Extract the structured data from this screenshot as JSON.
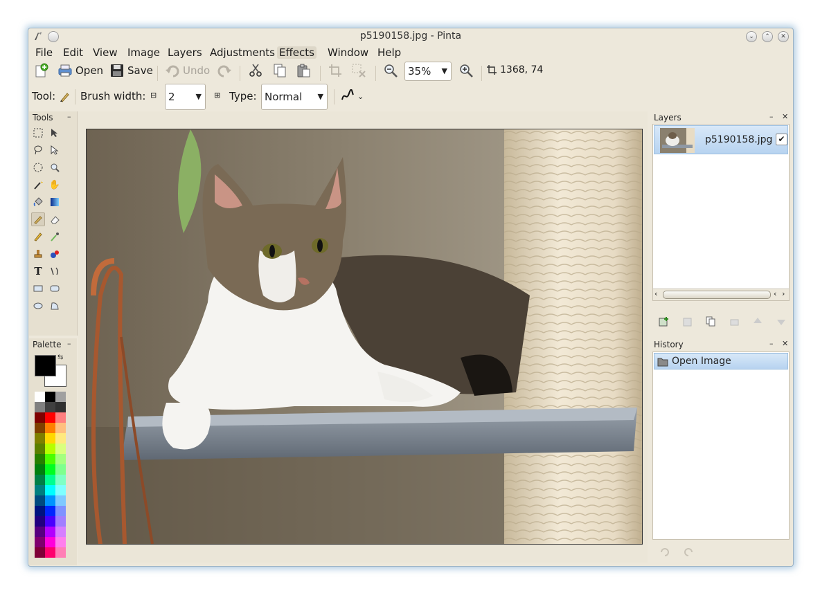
{
  "window": {
    "title": "p5190158.jpg - Pinta"
  },
  "menu": [
    "File",
    "Edit",
    "View",
    "Image",
    "Layers",
    "Adjustments",
    "Effects",
    "Window",
    "Help"
  ],
  "menu_active_index": 6,
  "toolbar": {
    "open_label": "Open",
    "save_label": "Save",
    "undo_label": "Undo",
    "zoom_value": "35%",
    "cursor_position": "1368, 74"
  },
  "tool_options": {
    "tool_label": "Tool:",
    "brush_width_label": "Brush width:",
    "brush_width_value": "2",
    "type_label": "Type:",
    "type_value": "Normal"
  },
  "tools_panel": {
    "title": "Tools",
    "tools": [
      "rectangle-select",
      "move-selected",
      "lasso-select",
      "move-selection",
      "ellipse-select",
      "zoom",
      "magic-wand",
      "pan",
      "paint-bucket",
      "gradient",
      "paintbrush",
      "eraser",
      "pencil",
      "color-picker",
      "clone-stamp",
      "recolor",
      "text",
      "line-curve",
      "rectangle",
      "rounded-rectangle",
      "ellipse",
      "freeform-shape"
    ],
    "selected_tool": "paintbrush"
  },
  "palette_panel": {
    "title": "Palette",
    "primary_color": "#000000",
    "secondary_color": "#ffffff",
    "colors": [
      [
        "#ffffff",
        "#000000",
        "#a0a0a0"
      ],
      [
        "#808080",
        "#404040",
        "#303030"
      ],
      [
        "#7f0000",
        "#ff0000",
        "#ff7f7f"
      ],
      [
        "#7f3f00",
        "#ff7f00",
        "#ffbf7f"
      ],
      [
        "#7f7f00",
        "#ffd800",
        "#ffe97f"
      ],
      [
        "#5b7f00",
        "#b6ff00",
        "#daff7f"
      ],
      [
        "#267f00",
        "#4cff00",
        "#a5ff7f"
      ],
      [
        "#007f0e",
        "#00ff21",
        "#7fff8e"
      ],
      [
        "#007f46",
        "#00ff90",
        "#7fffc5"
      ],
      [
        "#007f7f",
        "#00ffff",
        "#7fffff"
      ],
      [
        "#004a7f",
        "#0094ff",
        "#7fc9ff"
      ],
      [
        "#00137f",
        "#0026ff",
        "#7f92ff"
      ],
      [
        "#21007f",
        "#4800ff",
        "#a17fff"
      ],
      [
        "#57007f",
        "#b200ff",
        "#d67fff"
      ],
      [
        "#7f006e",
        "#ff00dc",
        "#ff7fed"
      ],
      [
        "#7f0037",
        "#ff006e",
        "#ff7fb6"
      ]
    ]
  },
  "layers_panel": {
    "title": "Layers",
    "layers": [
      {
        "name": "p5190158.jpg",
        "visible": true
      }
    ]
  },
  "history_panel": {
    "title": "History",
    "items": [
      "Open Image"
    ]
  }
}
